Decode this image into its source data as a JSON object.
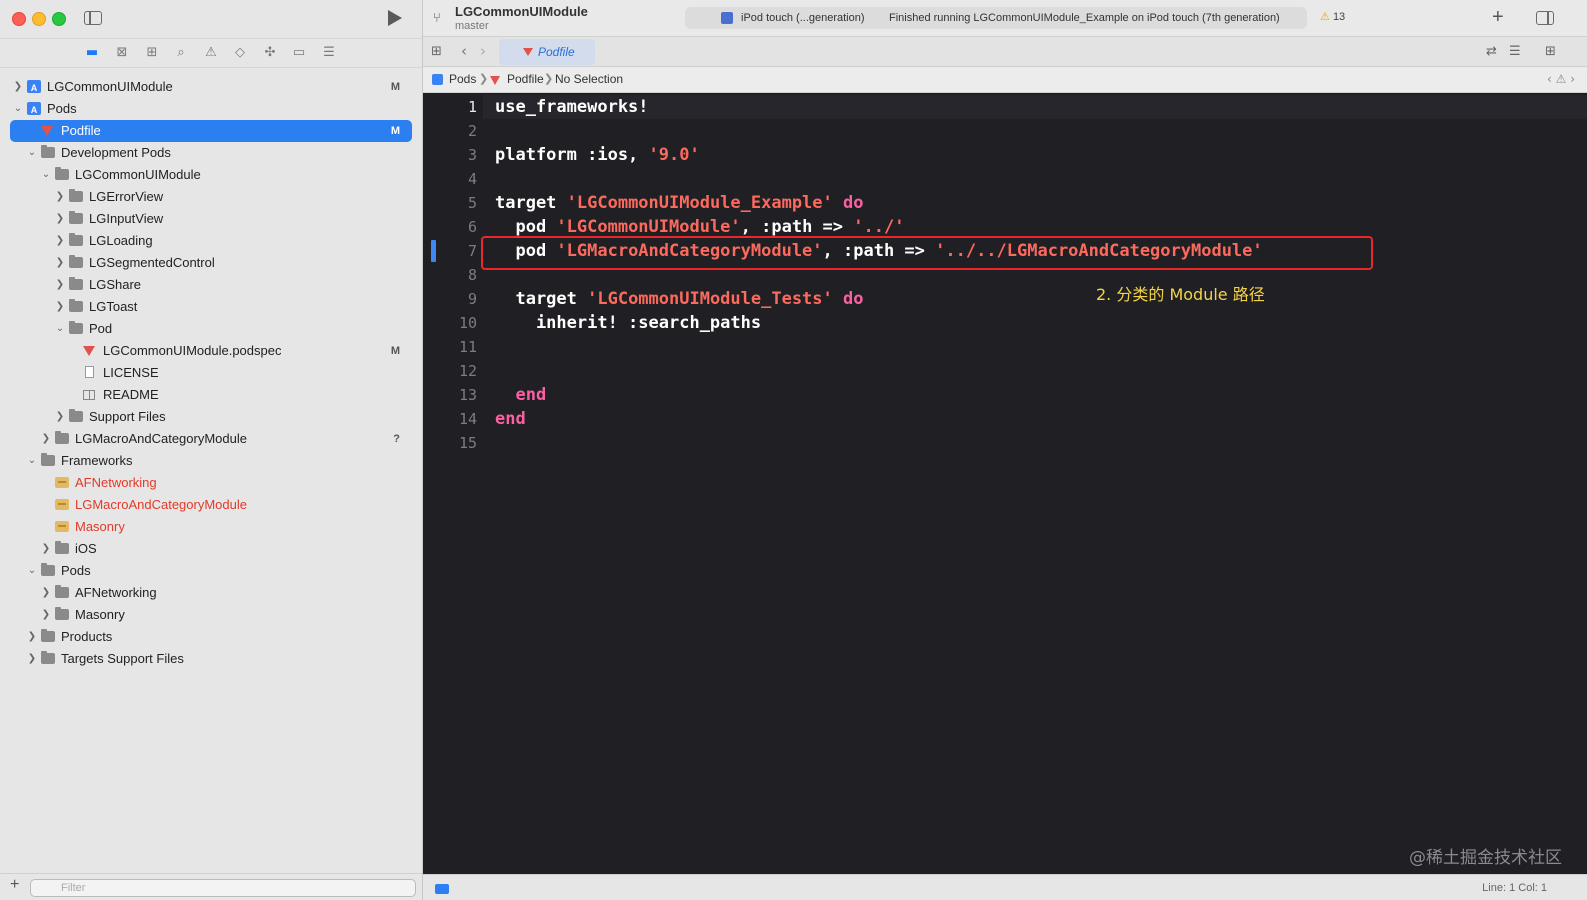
{
  "window": {
    "project": "LGCommonUIModule",
    "branch": "master"
  },
  "activity": {
    "device": "iPod touch (...generation)",
    "status": "Finished running LGCommonUIModule_Example on iPod touch (7th generation)",
    "warnings": "13"
  },
  "tab": {
    "label": "Podfile"
  },
  "jumpbar": {
    "items": [
      "Pods",
      "Podfile",
      "No Selection"
    ]
  },
  "tree": {
    "items": [
      {
        "label": "LGCommonUIModule",
        "badge": "M"
      },
      {
        "label": "Pods",
        "badge": ""
      },
      {
        "label": "Podfile",
        "badge": "M"
      },
      {
        "label": "Development Pods",
        "badge": ""
      },
      {
        "label": "LGCommonUIModule",
        "badge": ""
      },
      {
        "label": "LGErrorView",
        "badge": ""
      },
      {
        "label": "LGInputView",
        "badge": ""
      },
      {
        "label": "LGLoading",
        "badge": ""
      },
      {
        "label": "LGSegmentedControl",
        "badge": ""
      },
      {
        "label": "LGShare",
        "badge": ""
      },
      {
        "label": "LGToast",
        "badge": ""
      },
      {
        "label": "Pod",
        "badge": ""
      },
      {
        "label": "LGCommonUIModule.podspec",
        "badge": "M"
      },
      {
        "label": "LICENSE",
        "badge": ""
      },
      {
        "label": "README",
        "badge": ""
      },
      {
        "label": "Support Files",
        "badge": ""
      },
      {
        "label": "LGMacroAndCategoryModule",
        "badge": "?"
      },
      {
        "label": "Frameworks",
        "badge": ""
      },
      {
        "label": "AFNetworking",
        "badge": ""
      },
      {
        "label": "LGMacroAndCategoryModule",
        "badge": ""
      },
      {
        "label": "Masonry",
        "badge": ""
      },
      {
        "label": "iOS",
        "badge": ""
      },
      {
        "label": "Pods",
        "badge": ""
      },
      {
        "label": "AFNetworking",
        "badge": ""
      },
      {
        "label": "Masonry",
        "badge": ""
      },
      {
        "label": "Products",
        "badge": ""
      },
      {
        "label": "Targets Support Files",
        "badge": ""
      }
    ]
  },
  "filter": {
    "placeholder": "Filter"
  },
  "code": {
    "line_numbers": [
      "1",
      "2",
      "3",
      "4",
      "5",
      "6",
      "7",
      "8",
      "9",
      "10",
      "11",
      "12",
      "13",
      "14",
      "15"
    ],
    "l1": "use_frameworks!",
    "l3a": "platform :ios, ",
    "l3b": "'9.0'",
    "l5a": "target ",
    "l5b": "'LGCommonUIModule_Example'",
    "l5c": " do",
    "l6a": "  pod ",
    "l6b": "'LGCommonUIModule'",
    "l6c": ", :path => ",
    "l6d": "'../'",
    "l7a": "  pod ",
    "l7b": "'LGMacroAndCategoryModule'",
    "l7c": ", :path => ",
    "l7d": "'../../LGMacroAndCategoryModule'",
    "l9a": "  target ",
    "l9b": "'LGCommonUIModule_Tests'",
    "l9c": " do",
    "l10": "    inherit! :search_paths",
    "l13": "  end",
    "l14": "end"
  },
  "annotation": "2. 分类的 Module 路径",
  "watermark": "@稀土掘金技术社区",
  "status": {
    "position": "Line: 1  Col: 1"
  }
}
